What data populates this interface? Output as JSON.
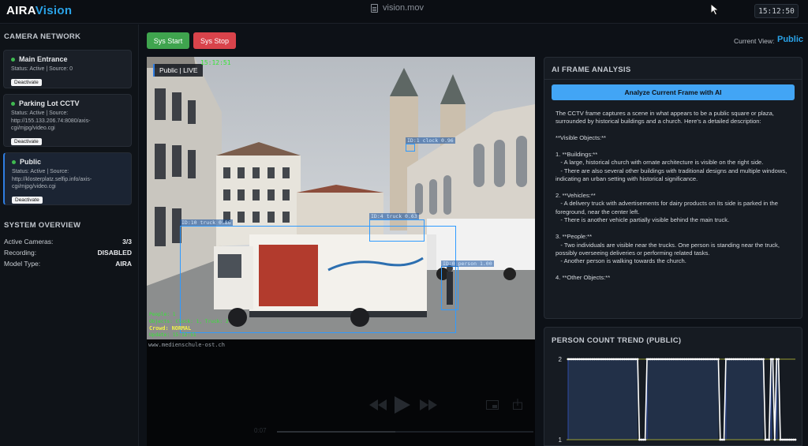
{
  "app": {
    "logo_part1": "AIRA",
    "logo_part2": "Vision",
    "window_title": "vision.mov",
    "clock": "15:12:50"
  },
  "sidebar": {
    "camera_network_title": "CAMERA NETWORK",
    "cameras": [
      {
        "name": "Main Entrance",
        "status": "Status: Active | Source: 0",
        "button": "Deactivate",
        "selected": false
      },
      {
        "name": "Parking Lot CCTV",
        "status": "Status: Active | Source: http://155.133.206.74:8080/axis-cgi/mjpg/video.cgi",
        "button": "Deactivate",
        "selected": false
      },
      {
        "name": "Public",
        "status": "Status: Active | Source: http://klosterplatz.selfip.info/axis-cgi/mjpg/video.cgi",
        "button": "Deactivate",
        "selected": true
      }
    ],
    "overview_title": "SYSTEM OVERVIEW",
    "overview": [
      {
        "label": "Active Cameras:",
        "value": "3/3"
      },
      {
        "label": "Recording:",
        "value": "DISABLED"
      },
      {
        "label": "Model Type:",
        "value": "AIRA"
      }
    ]
  },
  "controls": {
    "start_label": "Sys Start",
    "stop_label": "Sys Stop",
    "current_view_label": "Current View:",
    "current_view_value": "Public"
  },
  "video": {
    "badge": "Public | LIVE",
    "timestamp_top": "15:12:51",
    "detections": [
      {
        "label": "ID:1 clock 0.96"
      },
      {
        "label": "ID:4 truck 0.63"
      },
      {
        "label": "ID:10 truck 0.86"
      },
      {
        "label": "ID:0 person 1.00"
      }
    ],
    "stats": {
      "people": "People: 1",
      "objects": "Objects: Clock: 1, Truck: 2",
      "crowd": "Crowd: NORMAL",
      "update": "Update: 15:12:51"
    },
    "watermark": "www.medienschule-ost.ch",
    "player_time": "0:07"
  },
  "ai": {
    "title": "AI FRAME ANALYSIS",
    "button": "Analyze Current Frame with AI",
    "text": "The CCTV frame captures a scene in what appears to be a public square or plaza, surrounded by historical buildings and a church. Here's a detailed description:\n\n**Visible Objects:**\n\n1. **Buildings:**\n   - A large, historical church with ornate architecture is visible on the right side.\n   - There are also several other buildings with traditional designs and multiple windows, indicating an urban setting with historical significance.\n\n2. **Vehicles:**\n   - A delivery truck with advertisements for dairy products on its side is parked in the foreground, near the center left.\n   - There is another vehicle partially visible behind the main truck.\n\n3. **People:**\n   - Two individuals are visible near the trucks. One person is standing near the truck, possibly overseeing deliveries or performing related tasks.\n   - Another person is walking towards the church.\n\n4. **Other Objects:**"
  },
  "chart_data": {
    "type": "line",
    "title": "PERSON COUNT TREND (PUBLIC)",
    "ylim": [
      1,
      2
    ],
    "yticks": [
      "1",
      "2"
    ],
    "series": [
      {
        "values": [
          2,
          2,
          2,
          2,
          2,
          2,
          2,
          2,
          2,
          2,
          2,
          2,
          2,
          2,
          2,
          2,
          2,
          2,
          2,
          2,
          2,
          2,
          2,
          2,
          2,
          2,
          2,
          2,
          2,
          2,
          2,
          2,
          2,
          2,
          2,
          2,
          2,
          2,
          1,
          1,
          1,
          1,
          2,
          2,
          2,
          2,
          2,
          2,
          2,
          2,
          2,
          2,
          2,
          2,
          2,
          2,
          2,
          2,
          2,
          2,
          2,
          2,
          2,
          2,
          2,
          2,
          2,
          2,
          2,
          2,
          2,
          2,
          2,
          2,
          2,
          2,
          2,
          2,
          2,
          2,
          2,
          1,
          1,
          1,
          2,
          2,
          2,
          2,
          2,
          2,
          2,
          2,
          2,
          2,
          2,
          2,
          2,
          2,
          2,
          2,
          2,
          2,
          2,
          2,
          2,
          1,
          1,
          1,
          2,
          2,
          1,
          2,
          2,
          1,
          1,
          1,
          1,
          1,
          1,
          1,
          1,
          1
        ]
      }
    ],
    "colors": {
      "line": "#ffffff",
      "marker": "#ffffff",
      "grid": "#c6c93a",
      "band": "#223048",
      "band_edge": "#2d4aa8"
    }
  }
}
